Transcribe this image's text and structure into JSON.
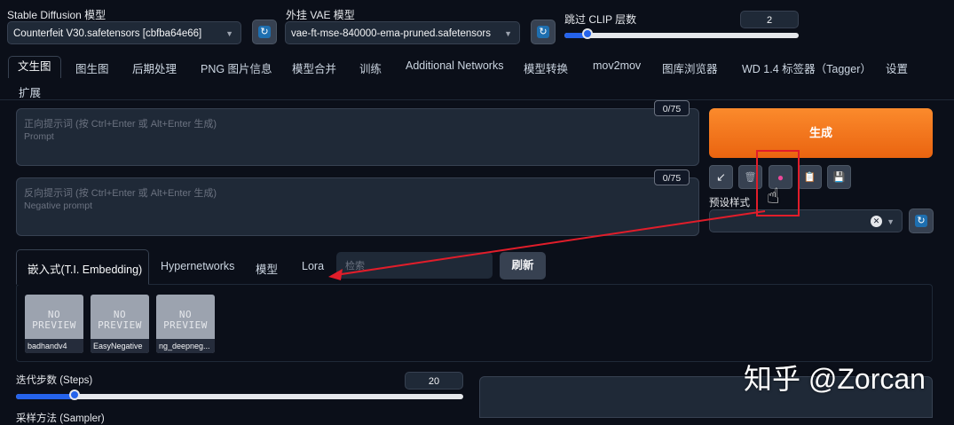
{
  "header": {
    "sd_model_label": "Stable Diffusion 模型",
    "sd_model_value": "Counterfeit V30.safetensors [cbfba64e66]",
    "vae_label": "外挂 VAE 模型",
    "vae_value": "vae-ft-mse-840000-ema-pruned.safetensors",
    "clip_label": "跳过 CLIP 层数",
    "clip_value": "2",
    "clip_level": 0.1
  },
  "tabs": [
    "文生图",
    "图生图",
    "后期处理",
    "PNG 图片信息",
    "模型合并",
    "训练",
    "Additional Networks",
    "模型转换",
    "mov2mov",
    "图库浏览器",
    "WD 1.4 标签器（Tagger）",
    "设置",
    "扩展"
  ],
  "prompt": {
    "placeholder_line1": "正向提示词 (按 Ctrl+Enter 或 Alt+Enter 生成)",
    "placeholder_line2": "Prompt",
    "counter": "0/75"
  },
  "negative": {
    "placeholder_line1": "反向提示词 (按 Ctrl+Enter 或 Alt+Enter 生成)",
    "placeholder_line2": "Negative prompt",
    "counter": "0/75"
  },
  "generate_label": "生成",
  "tools": {
    "icons": [
      "arrow-icon",
      "trash-icon",
      "show-extra-networks-icon",
      "clipboard-icon",
      "save-style-icon"
    ],
    "glyphs": [
      "↙",
      "🗑",
      "●",
      "📋",
      "💾"
    ]
  },
  "styles_label": "预设样式",
  "extra_networks": {
    "tabs": [
      "嵌入式(T.I. Embedding)",
      "Hypernetworks",
      "模型",
      "Lora"
    ],
    "search_placeholder": "检索",
    "refresh_label": "刷新",
    "cards": [
      {
        "line1": "NO",
        "line2": "PREVIEW",
        "name": "badhandv4"
      },
      {
        "line1": "NO",
        "line2": "PREVIEW",
        "name": "EasyNegative"
      },
      {
        "line1": "NO",
        "line2": "PREVIEW",
        "name": "ng_deepneg..."
      }
    ]
  },
  "steps": {
    "label": "迭代步数 (Steps)",
    "value": "20",
    "level": 0.13
  },
  "sampler_label": "采样方法 (Sampler)",
  "watermark": "知乎 @Zorcan",
  "colors": {
    "accent": "#f97316",
    "annotation": "#e11d2a",
    "slider": "#2563eb",
    "background": "#0b0f19"
  }
}
